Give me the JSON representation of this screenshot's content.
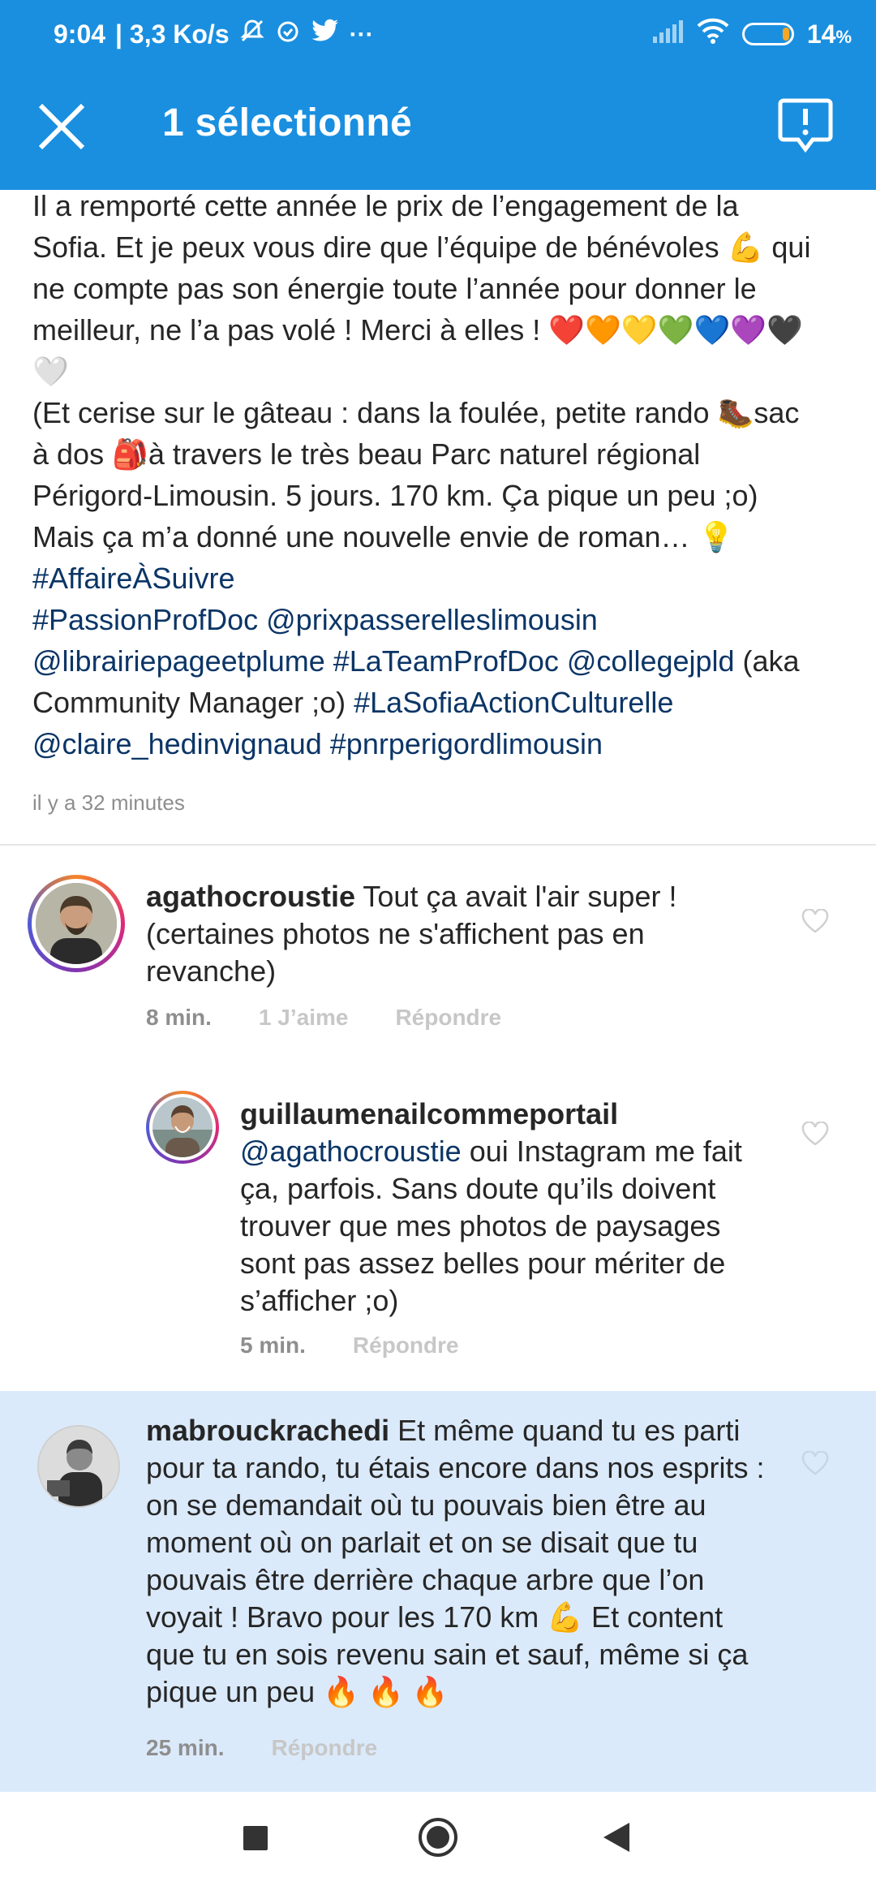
{
  "status_bar": {
    "time": "9:04",
    "speed": "| 3,3 Ko/s",
    "battery": "14",
    "battery_unit": "%",
    "icons": [
      "mute-icon",
      "alarm-icon",
      "twitter-icon",
      "more-icon",
      "signal-icon",
      "wifi-icon",
      "battery-icon"
    ]
  },
  "app_bar": {
    "title": "1 sélectionné",
    "close_icon": "close-icon",
    "report_icon": "report-icon"
  },
  "caption": {
    "lines": [
      "Il a remporté cette année le prix de l’engagement de la",
      "Sofia. Et je peux vous dire que l’équipe de bénévoles 💪 qui",
      "ne compte pas son énergie toute l’année pour donner le",
      "meilleur, ne l’a pas volé ! Merci à elles ! ❤️🧡💛💚💙💜🖤",
      "🤍",
      "(Et cerise sur le gâteau : dans la foulée, petite rando 🥾sac",
      "à dos 🎒à travers le très beau Parc naturel régional",
      "Périgord-Limousin. 5 jours. 170 km. Ça pique un peu ;o)",
      "Mais ça m’a donné une nouvelle envie de roman… 💡"
    ],
    "tags_line1": "#AffaireÀSuivre",
    "tags_line2": "#PassionProfDoc @prixpasserelleslimousin",
    "tags_line3_a": "@librairiepageetplume #LaTeamProfDoc @collegejpld",
    "tags_line3_b": " (aka",
    "line4_a": "Community Manager ;o) ",
    "line4_b": "#LaSofiaActionCulturelle",
    "line5": "@claire_hedinvignaud #pnrperigordlimousin",
    "timestamp": "il y a 32 minutes"
  },
  "comments": [
    {
      "username": "agathocroustie",
      "text": " Tout ça avait l'air super ! (certaines photos ne s'affichent pas en revanche)",
      "time": "8 min.",
      "likes": "1 J’aime",
      "reply": "Répondre"
    },
    {
      "username": "guillaumenailcommeportail",
      "mention": "@agathocroustie",
      "text": " oui Instagram me fait ça, parfois. Sans doute qu’ils doivent trouver que mes photos de paysages sont pas assez belles pour mériter de s’afficher ;o)",
      "time": "5 min.",
      "reply": "Répondre"
    },
    {
      "username": "mabrouckrachedi",
      "text": " Et même quand tu es parti pour ta rando, tu étais encore dans nos esprits : on se demandait où tu pouvais bien être au moment où on parlait et on se disait que tu pouvais être derrière chaque arbre que l’on voyait ! Bravo pour les 170 km 💪 Et content que tu en sois revenu sain et sauf, même si ça pique un peu 🔥 🔥 🔥",
      "time": "25 min.",
      "reply": "Répondre"
    }
  ],
  "nav_bar": {
    "icons": [
      "recents-icon",
      "home-icon",
      "back-icon"
    ]
  },
  "colors": {
    "app_bar": "#1a8fe0",
    "hashtag": "#0b3566",
    "selected_comment_bg": "#dbeafa"
  }
}
